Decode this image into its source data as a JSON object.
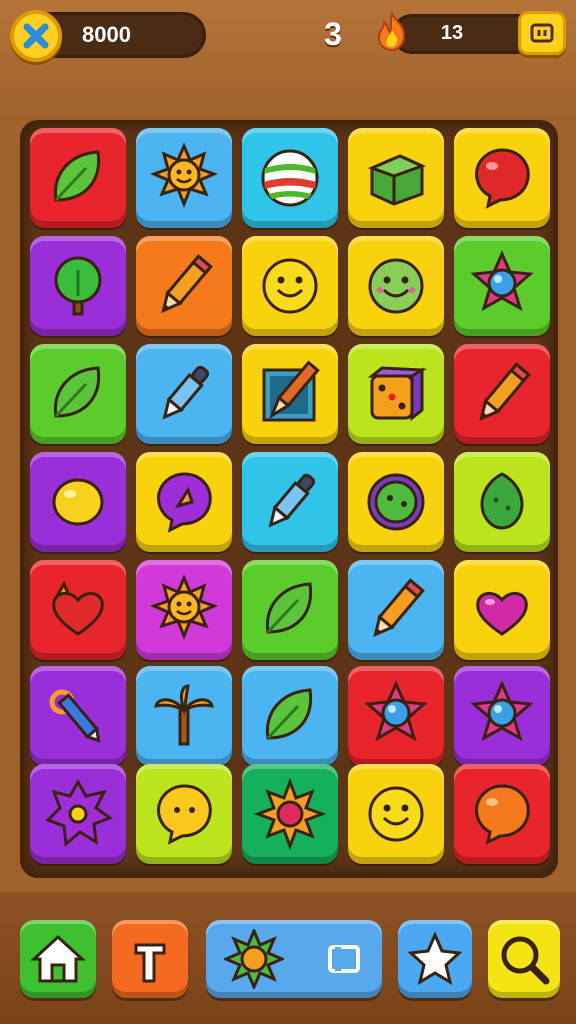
{
  "hud": {
    "coins": "8000",
    "level": "3",
    "fire_count": "13"
  },
  "colors": {
    "red": "#e8242c",
    "blue": "#4cb4f0",
    "yellow": "#f8d20c",
    "purple": "#9a2ed8",
    "orange": "#f47a1c",
    "green": "#5ccc2c",
    "lime": "#bce41c",
    "magenta": "#d03ad8",
    "cyan": "#30c4e8",
    "emerald": "#14b05c",
    "board": "#5e3416",
    "background": "#a0622c"
  },
  "board": {
    "rows": [
      [
        {
          "color": "red",
          "icon": "leaf-icon"
        },
        {
          "color": "blue",
          "icon": "sun-icon"
        },
        {
          "color": "cyan",
          "icon": "striped-ball-icon"
        },
        {
          "color": "yellow",
          "icon": "box-icon"
        },
        {
          "color": "yellow",
          "icon": "red-balloon-icon"
        }
      ],
      [
        {
          "color": "purple",
          "icon": "tree-icon"
        },
        {
          "color": "orange",
          "icon": "pencil-icon"
        },
        {
          "color": "yellow",
          "icon": "smiley-icon"
        },
        {
          "color": "yellow",
          "icon": "green-smiley-icon"
        },
        {
          "color": "green",
          "icon": "gem-star-icon"
        }
      ],
      [
        {
          "color": "green",
          "icon": "leaf-icon"
        },
        {
          "color": "blue",
          "icon": "dropper-icon"
        },
        {
          "color": "yellow",
          "icon": "brush-icon"
        },
        {
          "color": "lime",
          "icon": "dice-icon"
        },
        {
          "color": "red",
          "icon": "pencil-icon"
        }
      ],
      [
        {
          "color": "purple",
          "icon": "lemon-icon"
        },
        {
          "color": "yellow",
          "icon": "purple-bubble-icon"
        },
        {
          "color": "cyan",
          "icon": "dropper-icon"
        },
        {
          "color": "yellow",
          "icon": "green-orb-icon"
        },
        {
          "color": "lime",
          "icon": "cactus-icon"
        }
      ],
      [
        {
          "color": "red",
          "icon": "red-heart-icon"
        },
        {
          "color": "magenta",
          "icon": "sun-icon"
        },
        {
          "color": "green",
          "icon": "leaf-icon"
        },
        {
          "color": "blue",
          "icon": "pencil-icon"
        },
        {
          "color": "yellow",
          "icon": "pink-heart-icon"
        }
      ],
      [
        {
          "color": "purple",
          "icon": "key-icon"
        },
        {
          "color": "blue",
          "icon": "palm-icon"
        },
        {
          "color": "blue",
          "icon": "leaf-icon"
        },
        {
          "color": "red",
          "icon": "gem-star-icon"
        },
        {
          "color": "purple",
          "icon": "gem-star-icon"
        }
      ],
      [
        {
          "color": "purple",
          "icon": "spiky-ball-icon"
        },
        {
          "color": "lime",
          "icon": "yellow-bubble-icon"
        },
        {
          "color": "emerald",
          "icon": "flower-icon"
        },
        {
          "color": "yellow",
          "icon": "smiley-icon"
        },
        {
          "color": "red",
          "icon": "orange-bubble-icon"
        }
      ]
    ]
  },
  "bottom_bar": {
    "buttons": [
      {
        "name": "home-button",
        "icon": "home-icon",
        "color": "#40c030"
      },
      {
        "name": "undo-button",
        "icon": "undo-icon",
        "color": "#f46a20"
      },
      {
        "name": "powerup-bar",
        "icon": "sun-gem-icon",
        "color": "#5aa8ec"
      },
      {
        "name": "star-button",
        "icon": "star-icon",
        "color": "#4ca8f0"
      },
      {
        "name": "hint-button",
        "icon": "magnifier-icon",
        "color": "#f4e414"
      }
    ]
  }
}
